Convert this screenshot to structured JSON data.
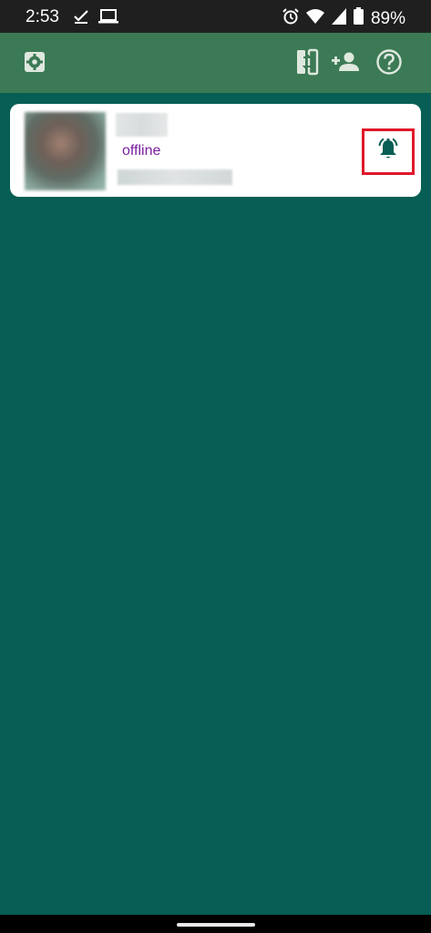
{
  "status_bar": {
    "time": "2:53",
    "battery": "89%",
    "icons": [
      "checkmark-download-icon",
      "laptop-icon",
      "alarm-icon",
      "wifi-icon",
      "signal-icon",
      "battery-icon"
    ]
  },
  "toolbar": {
    "icons": [
      "settings-icon",
      "switch-phone-icon",
      "add-person-icon",
      "help-icon"
    ]
  },
  "contact": {
    "status": "offline",
    "action_icon": "bell-icon"
  },
  "colors": {
    "background": "#075e54",
    "toolbar": "#3b7a55",
    "status_text": "#7a1fa2",
    "highlight": "#e0182b"
  }
}
